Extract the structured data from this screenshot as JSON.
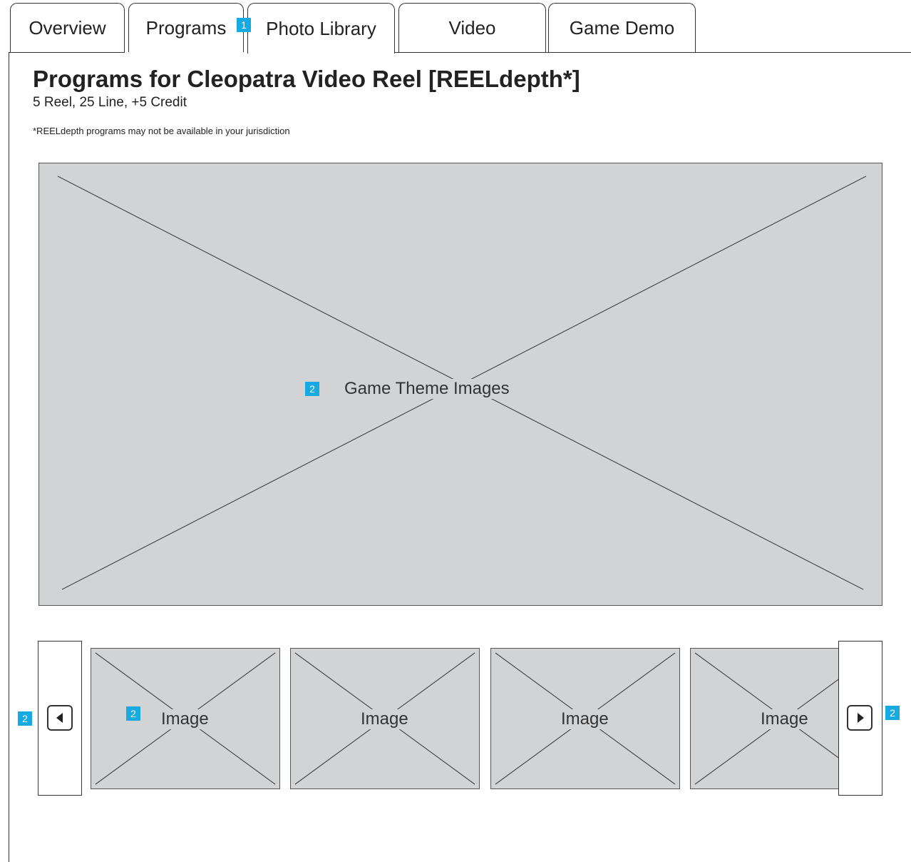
{
  "tabs": [
    {
      "label": "Overview",
      "active": false
    },
    {
      "label": "Programs",
      "active": false
    },
    {
      "label": "Photo Library",
      "active": true
    },
    {
      "label": "Video",
      "active": false
    },
    {
      "label": "Game Demo",
      "active": false
    }
  ],
  "header": {
    "title": "Programs for Cleopatra Video Reel [REELdepth*]",
    "subtitle": "5 Reel, 25 Line, +5 Credit",
    "note": "*REELdepth programs may not be available in your jurisdiction"
  },
  "main_image": {
    "label": "Game Theme Images"
  },
  "carousel": {
    "prev_icon": "chevron-left-icon",
    "next_icon": "chevron-right-icon",
    "thumbnails": [
      {
        "label": "Image"
      },
      {
        "label": "Image"
      },
      {
        "label": "Image"
      },
      {
        "label": "Image"
      }
    ]
  },
  "markers": {
    "tabs": "1",
    "main_image": "2",
    "prev": "2",
    "thumbnail": "2",
    "next": "2"
  },
  "colors": {
    "marker": "#17a9e1",
    "placeholder": "#d2d3d5",
    "outline": "#333333"
  }
}
